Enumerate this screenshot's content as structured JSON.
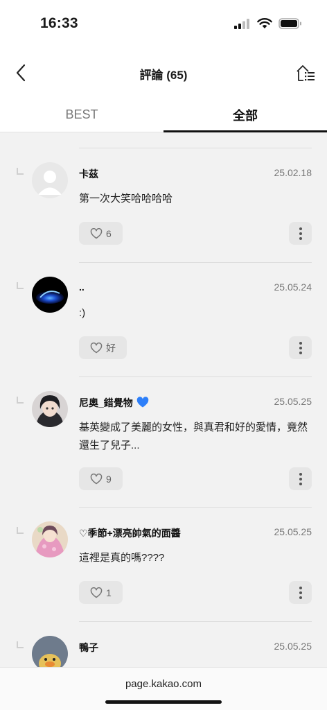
{
  "status_bar": {
    "time": "16:33"
  },
  "nav": {
    "title": "評論 (65)"
  },
  "tabs": [
    {
      "label": "BEST",
      "active": false
    },
    {
      "label": "全部",
      "active": true
    }
  ],
  "comments": [
    {
      "author": "卡茲",
      "date": "25.02.18",
      "text": "第一次大笑哈哈哈哈",
      "likes": "6",
      "avatar": "default-avatar"
    },
    {
      "author": "..",
      "date": "25.05.24",
      "text": ":)",
      "likes": "好",
      "avatar": "blue-swirl-avatar"
    },
    {
      "author": "尼奧_錯覺物",
      "date": "25.05.25",
      "text": "基英變成了美麗的女性，與真君和好的愛情，竟然還生了兒子...",
      "likes": "9",
      "avatar": "anime-character-avatar",
      "author_badge": "blue-heart-icon"
    },
    {
      "author": "♡季節+漂亮帥氣的面醬",
      "date": "25.05.25",
      "text": "這裡是真的嗎????",
      "likes": "1",
      "avatar": "pink-illustration-avatar"
    },
    {
      "author": "鴨子",
      "date": "25.05.25",
      "text": "",
      "likes": "",
      "avatar": "duck-avatar"
    }
  ],
  "url_bar": {
    "url": "page.kakao.com"
  },
  "colors": {
    "background": "#f2f2f2",
    "accent": "#111111",
    "badge_blue": "#2d7ff9"
  }
}
